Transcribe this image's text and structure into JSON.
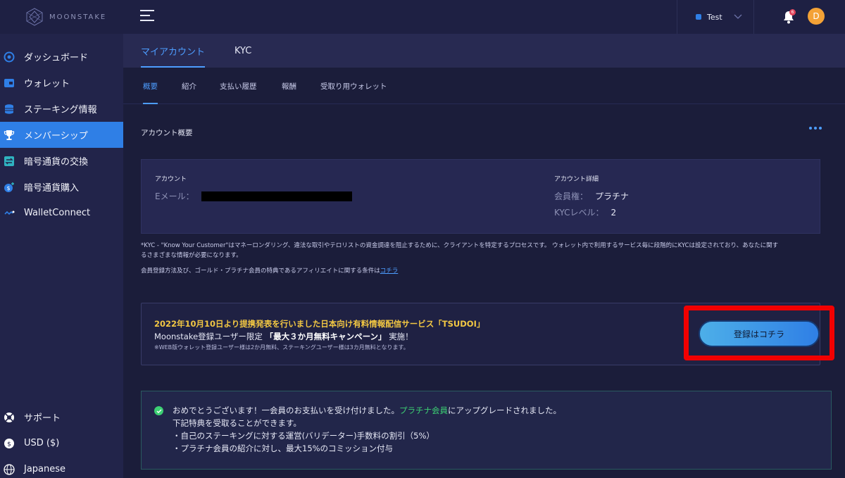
{
  "sidebar": {
    "logo_text": "MOONSTAKE",
    "items": [
      {
        "label": "ダッシュボード",
        "icon": "dashboard-icon"
      },
      {
        "label": "ウォレット",
        "icon": "wallet-icon"
      },
      {
        "label": "ステーキング情報",
        "icon": "database-icon"
      },
      {
        "label": "メンバーシップ",
        "icon": "trophy-icon"
      },
      {
        "label": "暗号通貨の交換",
        "icon": "exchange-icon"
      },
      {
        "label": "暗号通貨購入",
        "icon": "buy-crypto-icon"
      },
      {
        "label": "WalletConnect",
        "icon": "walletconnect-icon"
      }
    ],
    "bottom": [
      {
        "label": "サポート",
        "icon": "support-icon"
      },
      {
        "label": "USD ($)",
        "icon": "dollar-icon"
      },
      {
        "label": "Japanese",
        "icon": "globe-icon"
      }
    ]
  },
  "header": {
    "network": "Test",
    "notification_count": "6",
    "avatar_initial": "D"
  },
  "tabs": [
    "マイアカウント",
    "KYC"
  ],
  "subtabs": [
    "概要",
    "紹介",
    "支払い履歴",
    "報酬",
    "受取り用ウォレット"
  ],
  "overview": {
    "title": "アカウント概要",
    "account_heading": "アカウント",
    "email_label": "Eメール：",
    "details_heading": "アカウント詳細",
    "membership_label": "会員権：",
    "membership_value": "プラチナ",
    "kyc_label": "KYCレベル：",
    "kyc_value": "2"
  },
  "notes": {
    "kyc_line1": "*KYC - \"Know Your Customer\"はマネーロンダリング、違法な取引やテロリストの資金調達を阻止するために、クライアントを特定するプロセスです。 ウォレット内で利用するサービス毎に段階的にKYCは設定されており、あなたに関す",
    "kyc_line2": "るさまざまな情報が必要になります。",
    "affiliate_text": "会員登録方法及び、ゴールド・プラチナ会員の特典であるアフィリエイトに関する条件は",
    "affiliate_link": "コチラ"
  },
  "promo": {
    "title": "2022年10月10日より提携発表を行いました日本向け有料情報配信サービス「TSUDOI」",
    "line2_prefix": "Moonstake登録ユーザー限定",
    "line2_bold": "「最大３か月無料キャンペーン」",
    "line2_suffix": "実施！",
    "line3": "※WEB版ウォレット登録ユーザー様は2か月無料、ステーキングユーザー様は3カ月無料となります。",
    "button": "登録はコチラ"
  },
  "success": {
    "line1_prefix": "おめでとうございます！一会員のお支払いを受け付けました。",
    "line1_green": "プラチナ会員",
    "line1_suffix": "にアップグレードされました。",
    "line2": "下記特典を受取ることができます。",
    "line3": "・自己のステーキングに対する運営(バリデーター)手数料の割引（5%）",
    "line4": "・プラチナ会員の紹介に対し、最大15%のコミッション付与"
  },
  "colors": {
    "accent": "#2f7fe6",
    "highlight": "#f20000",
    "promo_title": "#f2c743",
    "success": "#3ccf73"
  }
}
